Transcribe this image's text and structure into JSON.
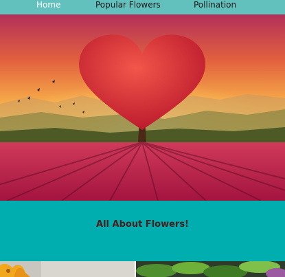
{
  "nav": {
    "items": [
      {
        "label": "Home",
        "active": true
      },
      {
        "label": "Popular Flowers",
        "active": false
      },
      {
        "label": "Pollination",
        "active": false
      }
    ]
  },
  "hero": {
    "image": "heart-shaped-tree-over-tulip-field-at-sunset"
  },
  "section": {
    "title": "All About Flowers!"
  },
  "gallery": {
    "images": [
      "yellow-flowers",
      "green-leaves"
    ]
  },
  "colors": {
    "nav_bg": "#62c0bd",
    "band_bg": "#00adaf",
    "title_text": "#4a1f1f"
  }
}
